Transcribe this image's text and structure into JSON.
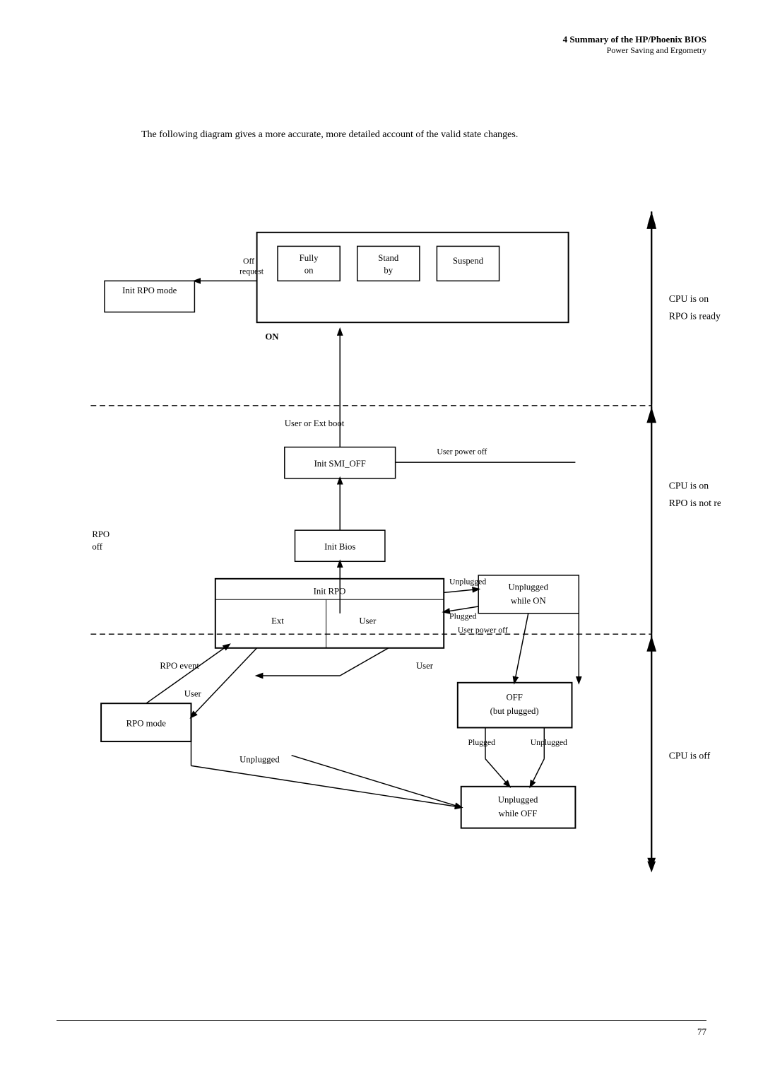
{
  "header": {
    "chapter": "4  Summary of the HP/Phoenix BIOS",
    "subtitle": "Power Saving and Ergometry"
  },
  "intro": {
    "text": "The following diagram gives a more accurate, more detailed account of the valid state changes."
  },
  "footer": {
    "page_number": "77"
  },
  "diagram": {
    "nodes": {
      "fully_on": "Fully on",
      "stand_by": "Stand by",
      "suspend": "Suspend",
      "init_rpo_mode": "Init RPO mode",
      "init_smi_off": "Init SMI_OFF",
      "init_bios": "Init Bios",
      "init_rpo": "Init RPO",
      "ext": "Ext",
      "user_box": "User",
      "unplugged_while_on": "Unplugged while ON",
      "rpo_mode": "RPO mode",
      "off_but_plugged": "OFF (but plugged)",
      "unplugged_while_off": "Unplugged while OFF"
    },
    "labels": {
      "off_request": "Off request",
      "on": "ON",
      "cpu_is_on_rpo_ready": "CPU is on\nRPO is ready",
      "user_or_ext_boot": "User or Ext boot",
      "user_power_off_1": "User power off",
      "rpo_off": "RPO off",
      "cpu_is_on_rpo_not_ready": "CPU is on\nRPO is not ready",
      "unplugged": "Unplugged",
      "plugged": "Plugged",
      "user_power_off_2": "User power off",
      "rpo_event": "RPO event",
      "user_1": "User",
      "user_2": "User",
      "cpu_is_off": "CPU is off",
      "unplugged_2": "Unplugged",
      "plugged_2": "Plugged",
      "unplugged_3": "Unplugged"
    }
  }
}
